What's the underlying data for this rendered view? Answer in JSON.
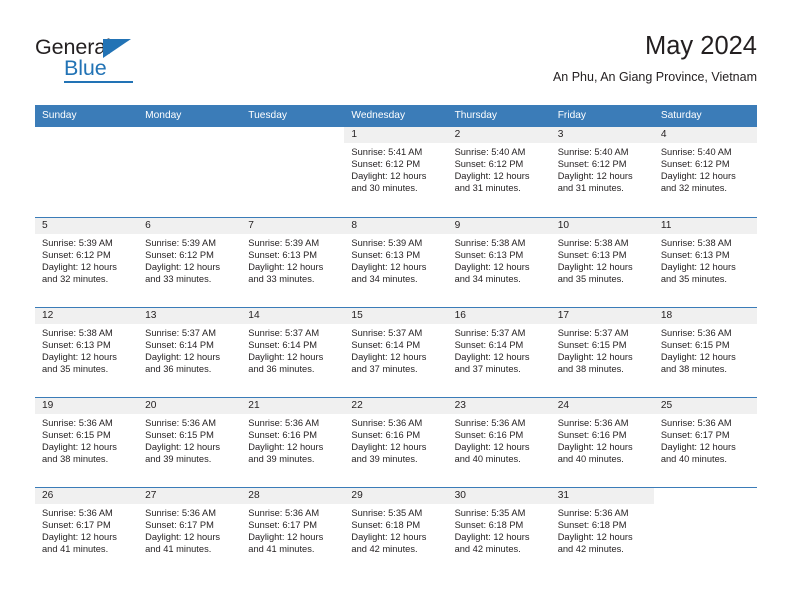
{
  "brand": {
    "name_part1": "General",
    "name_part2": "Blue",
    "triangle_icon": "triangle-icon",
    "accent_color": "#2273b5"
  },
  "header": {
    "title": "May 2024",
    "subtitle": "An Phu, An Giang Province, Vietnam"
  },
  "calendar": {
    "header_bg": "#3b7cb8",
    "daynum_bg": "#f0f0f0",
    "weekdays": [
      "Sunday",
      "Monday",
      "Tuesday",
      "Wednesday",
      "Thursday",
      "Friday",
      "Saturday"
    ],
    "weeks": [
      [
        {
          "day": "",
          "lines": []
        },
        {
          "day": "",
          "lines": []
        },
        {
          "day": "",
          "lines": []
        },
        {
          "day": "1",
          "lines": [
            "Sunrise: 5:41 AM",
            "Sunset: 6:12 PM",
            "Daylight: 12 hours",
            "and 30 minutes."
          ]
        },
        {
          "day": "2",
          "lines": [
            "Sunrise: 5:40 AM",
            "Sunset: 6:12 PM",
            "Daylight: 12 hours",
            "and 31 minutes."
          ]
        },
        {
          "day": "3",
          "lines": [
            "Sunrise: 5:40 AM",
            "Sunset: 6:12 PM",
            "Daylight: 12 hours",
            "and 31 minutes."
          ]
        },
        {
          "day": "4",
          "lines": [
            "Sunrise: 5:40 AM",
            "Sunset: 6:12 PM",
            "Daylight: 12 hours",
            "and 32 minutes."
          ]
        }
      ],
      [
        {
          "day": "5",
          "lines": [
            "Sunrise: 5:39 AM",
            "Sunset: 6:12 PM",
            "Daylight: 12 hours",
            "and 32 minutes."
          ]
        },
        {
          "day": "6",
          "lines": [
            "Sunrise: 5:39 AM",
            "Sunset: 6:12 PM",
            "Daylight: 12 hours",
            "and 33 minutes."
          ]
        },
        {
          "day": "7",
          "lines": [
            "Sunrise: 5:39 AM",
            "Sunset: 6:13 PM",
            "Daylight: 12 hours",
            "and 33 minutes."
          ]
        },
        {
          "day": "8",
          "lines": [
            "Sunrise: 5:39 AM",
            "Sunset: 6:13 PM",
            "Daylight: 12 hours",
            "and 34 minutes."
          ]
        },
        {
          "day": "9",
          "lines": [
            "Sunrise: 5:38 AM",
            "Sunset: 6:13 PM",
            "Daylight: 12 hours",
            "and 34 minutes."
          ]
        },
        {
          "day": "10",
          "lines": [
            "Sunrise: 5:38 AM",
            "Sunset: 6:13 PM",
            "Daylight: 12 hours",
            "and 35 minutes."
          ]
        },
        {
          "day": "11",
          "lines": [
            "Sunrise: 5:38 AM",
            "Sunset: 6:13 PM",
            "Daylight: 12 hours",
            "and 35 minutes."
          ]
        }
      ],
      [
        {
          "day": "12",
          "lines": [
            "Sunrise: 5:38 AM",
            "Sunset: 6:13 PM",
            "Daylight: 12 hours",
            "and 35 minutes."
          ]
        },
        {
          "day": "13",
          "lines": [
            "Sunrise: 5:37 AM",
            "Sunset: 6:14 PM",
            "Daylight: 12 hours",
            "and 36 minutes."
          ]
        },
        {
          "day": "14",
          "lines": [
            "Sunrise: 5:37 AM",
            "Sunset: 6:14 PM",
            "Daylight: 12 hours",
            "and 36 minutes."
          ]
        },
        {
          "day": "15",
          "lines": [
            "Sunrise: 5:37 AM",
            "Sunset: 6:14 PM",
            "Daylight: 12 hours",
            "and 37 minutes."
          ]
        },
        {
          "day": "16",
          "lines": [
            "Sunrise: 5:37 AM",
            "Sunset: 6:14 PM",
            "Daylight: 12 hours",
            "and 37 minutes."
          ]
        },
        {
          "day": "17",
          "lines": [
            "Sunrise: 5:37 AM",
            "Sunset: 6:15 PM",
            "Daylight: 12 hours",
            "and 38 minutes."
          ]
        },
        {
          "day": "18",
          "lines": [
            "Sunrise: 5:36 AM",
            "Sunset: 6:15 PM",
            "Daylight: 12 hours",
            "and 38 minutes."
          ]
        }
      ],
      [
        {
          "day": "19",
          "lines": [
            "Sunrise: 5:36 AM",
            "Sunset: 6:15 PM",
            "Daylight: 12 hours",
            "and 38 minutes."
          ]
        },
        {
          "day": "20",
          "lines": [
            "Sunrise: 5:36 AM",
            "Sunset: 6:15 PM",
            "Daylight: 12 hours",
            "and 39 minutes."
          ]
        },
        {
          "day": "21",
          "lines": [
            "Sunrise: 5:36 AM",
            "Sunset: 6:16 PM",
            "Daylight: 12 hours",
            "and 39 minutes."
          ]
        },
        {
          "day": "22",
          "lines": [
            "Sunrise: 5:36 AM",
            "Sunset: 6:16 PM",
            "Daylight: 12 hours",
            "and 39 minutes."
          ]
        },
        {
          "day": "23",
          "lines": [
            "Sunrise: 5:36 AM",
            "Sunset: 6:16 PM",
            "Daylight: 12 hours",
            "and 40 minutes."
          ]
        },
        {
          "day": "24",
          "lines": [
            "Sunrise: 5:36 AM",
            "Sunset: 6:16 PM",
            "Daylight: 12 hours",
            "and 40 minutes."
          ]
        },
        {
          "day": "25",
          "lines": [
            "Sunrise: 5:36 AM",
            "Sunset: 6:17 PM",
            "Daylight: 12 hours",
            "and 40 minutes."
          ]
        }
      ],
      [
        {
          "day": "26",
          "lines": [
            "Sunrise: 5:36 AM",
            "Sunset: 6:17 PM",
            "Daylight: 12 hours",
            "and 41 minutes."
          ]
        },
        {
          "day": "27",
          "lines": [
            "Sunrise: 5:36 AM",
            "Sunset: 6:17 PM",
            "Daylight: 12 hours",
            "and 41 minutes."
          ]
        },
        {
          "day": "28",
          "lines": [
            "Sunrise: 5:36 AM",
            "Sunset: 6:17 PM",
            "Daylight: 12 hours",
            "and 41 minutes."
          ]
        },
        {
          "day": "29",
          "lines": [
            "Sunrise: 5:35 AM",
            "Sunset: 6:18 PM",
            "Daylight: 12 hours",
            "and 42 minutes."
          ]
        },
        {
          "day": "30",
          "lines": [
            "Sunrise: 5:35 AM",
            "Sunset: 6:18 PM",
            "Daylight: 12 hours",
            "and 42 minutes."
          ]
        },
        {
          "day": "31",
          "lines": [
            "Sunrise: 5:36 AM",
            "Sunset: 6:18 PM",
            "Daylight: 12 hours",
            "and 42 minutes."
          ]
        },
        {
          "day": "",
          "lines": []
        }
      ]
    ]
  }
}
